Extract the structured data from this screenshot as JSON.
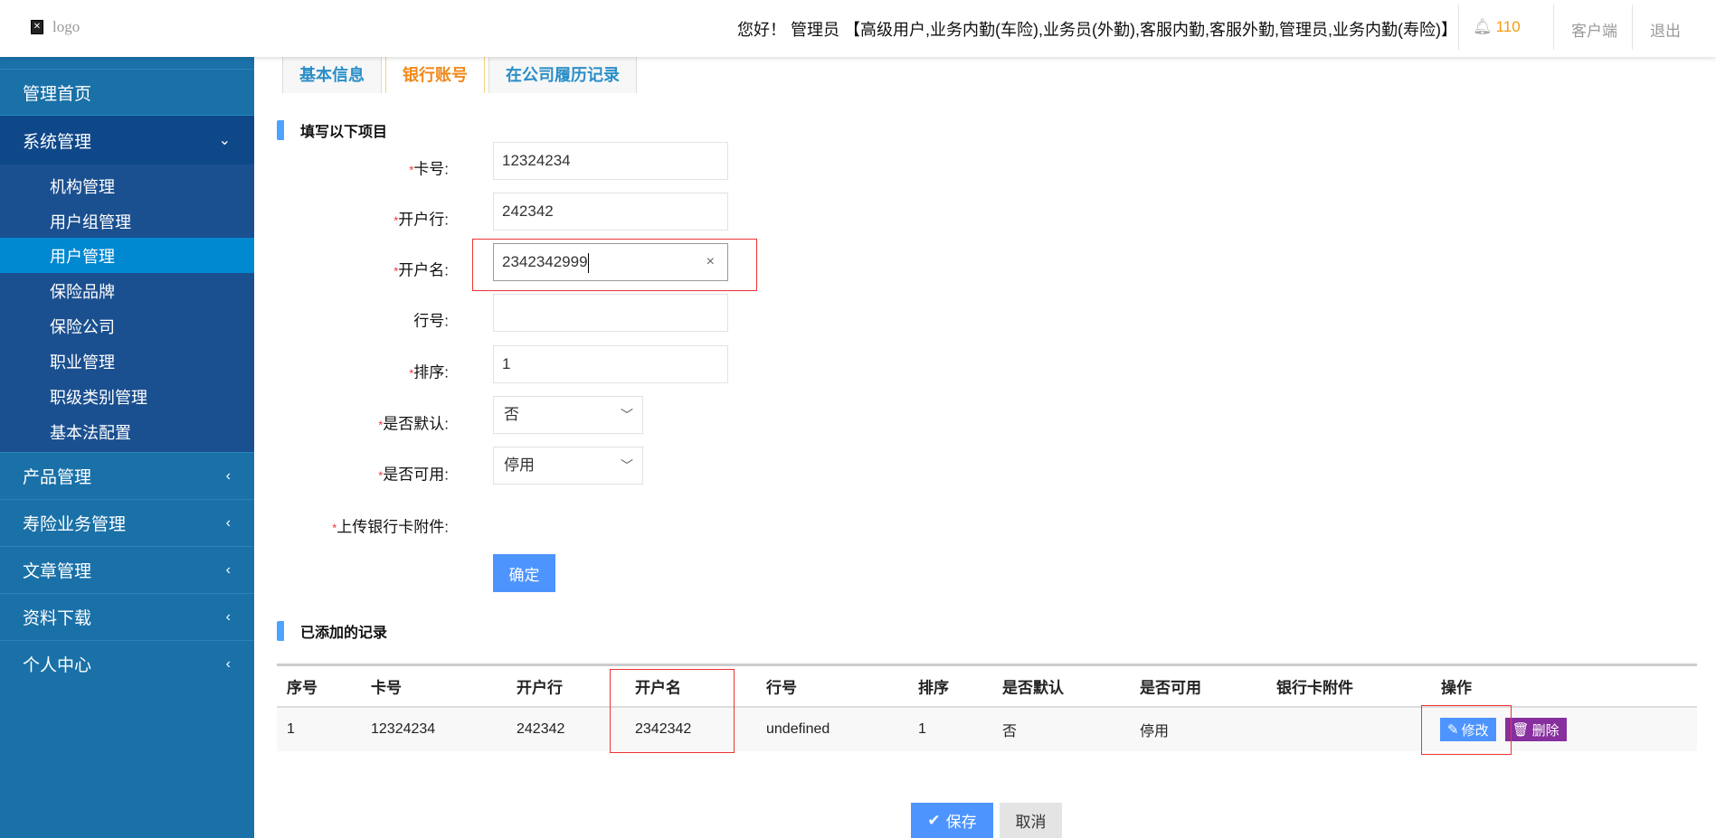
{
  "header": {
    "logo_text": "logo",
    "greeting": "您好！ 管理员 【高级用户,业务内勤(车险),业务员(外勤),客服内勤,客服外勤,管理员,业务内勤(寿险)】",
    "notification_count": "110",
    "client_link": "客户端",
    "logout_link": "退出"
  },
  "sidebar": {
    "items": [
      {
        "label": "管理首页"
      },
      {
        "label": "系统管理",
        "expanded": true
      },
      {
        "label": "产品管理"
      },
      {
        "label": "寿险业务管理"
      },
      {
        "label": "文章管理"
      },
      {
        "label": "资料下载"
      },
      {
        "label": "个人中心"
      }
    ],
    "subitems": [
      {
        "label": "机构管理"
      },
      {
        "label": "用户组管理"
      },
      {
        "label": "用户管理",
        "active": true
      },
      {
        "label": "保险品牌"
      },
      {
        "label": "保险公司"
      },
      {
        "label": "职业管理"
      },
      {
        "label": "职级类别管理"
      },
      {
        "label": "基本法配置"
      }
    ]
  },
  "tabs": [
    {
      "label": "基本信息"
    },
    {
      "label": "银行账号",
      "active": true
    },
    {
      "label": "在公司履历记录"
    }
  ],
  "form": {
    "section_title": "填写以下项目",
    "required_mark": "*",
    "card_no": {
      "label": "卡号:",
      "value": "12324234"
    },
    "bank": {
      "label": "开户行:",
      "value": "242342"
    },
    "account_name": {
      "label": "开户名:",
      "value": "2342342999",
      "clear": "×"
    },
    "bank_code": {
      "label": "行号:",
      "value": ""
    },
    "order": {
      "label": "排序:",
      "value": "1"
    },
    "is_default": {
      "label": "是否默认:",
      "value": "否"
    },
    "is_enabled": {
      "label": "是否可用:",
      "value": "停用"
    },
    "attachment": {
      "label": "上传银行卡附件:"
    },
    "confirm_label": "确定"
  },
  "records": {
    "section_title": "已添加的记录",
    "columns": [
      "序号",
      "卡号",
      "开户行",
      "开户名",
      "行号",
      "排序",
      "是否默认",
      "是否可用",
      "银行卡附件",
      "操作"
    ],
    "rows": [
      {
        "cells": [
          "1",
          "12324234",
          "242342",
          "2342342",
          "undefined",
          "1",
          "否",
          "停用",
          ""
        ],
        "edit_label": "修改",
        "delete_label": "删除"
      }
    ]
  },
  "footer": {
    "save_label": "保存",
    "cancel_label": "取消"
  },
  "colors": {
    "sidebar": "#1a71a8",
    "active": "#0088d1",
    "primary": "#4d94ff",
    "delete": "#872f9e",
    "tab_active": "#f0891c"
  }
}
